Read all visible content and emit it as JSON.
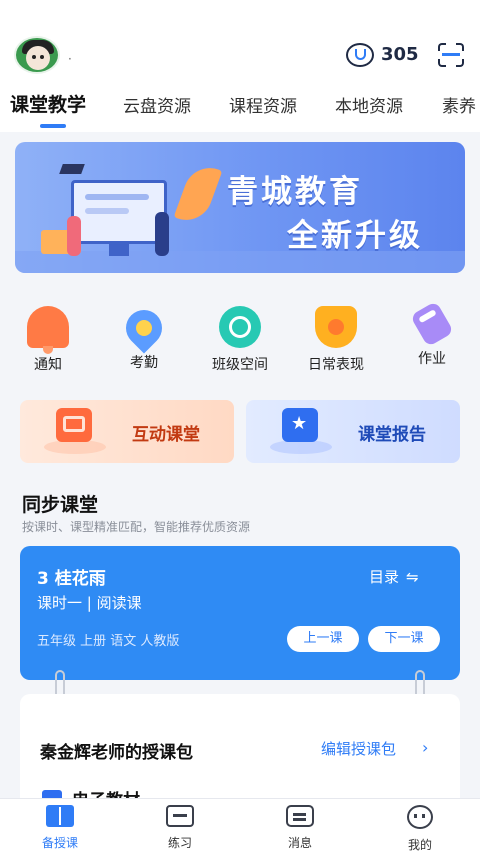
{
  "header": {
    "nickname": "·",
    "coin_icon": "coin-icon",
    "coin_count": "305",
    "scan_icon": "scan-icon"
  },
  "tabs": [
    {
      "label": "课堂教学",
      "active": true
    },
    {
      "label": "云盘资源"
    },
    {
      "label": "课程资源"
    },
    {
      "label": "本地资源"
    },
    {
      "label": "素养"
    }
  ],
  "banner": {
    "line1": "青城教育",
    "line2": "全新升级"
  },
  "functions": [
    {
      "label": "通知",
      "icon": "bell-icon"
    },
    {
      "label": "考勤",
      "icon": "location-icon"
    },
    {
      "label": "班级空间",
      "icon": "class-space-icon"
    },
    {
      "label": "日常表现",
      "icon": "medal-icon"
    },
    {
      "label": "作业",
      "icon": "homework-icon"
    }
  ],
  "cards": {
    "interactive": "互动课堂",
    "report": "课堂报告"
  },
  "sync": {
    "title": "同步课堂",
    "subtitle": "按课时、课型精准匹配，智能推荐优质资源"
  },
  "lesson": {
    "title": "3  桂花雨",
    "toc": "目录",
    "toc_icon": "⇋",
    "subtitle": "课时一  |  阅读课",
    "meta": "五年级  上册  语文  人教版",
    "prev": "上一课",
    "next": "下一课"
  },
  "package": {
    "title": "秦金辉老师的授课包",
    "edit": "编辑授课包",
    "chevron": "›",
    "item": "电子教材"
  },
  "bottom_nav": [
    {
      "label": "备授课",
      "active": true
    },
    {
      "label": "练习"
    },
    {
      "label": "消息"
    },
    {
      "label": "我的"
    }
  ],
  "colors": {
    "accent": "#2f7cf6",
    "lesson_card": "#2f8bf4",
    "interactive_text": "#c23a12",
    "report_text": "#1f4bb8"
  }
}
